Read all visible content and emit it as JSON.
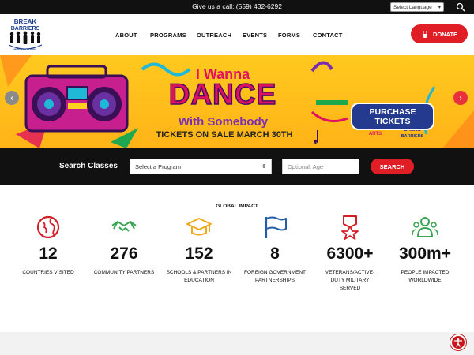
{
  "topbar": {
    "call_text": "Give us a call: (559) 432-6292",
    "language": "Select Language"
  },
  "logo": {
    "line1": "BREAK",
    "line2": "BARRIERS",
    "line3": "INTERNATIONAL"
  },
  "nav": {
    "items": [
      "ABOUT",
      "PROGRAMS",
      "OUTREACH",
      "EVENTS",
      "FORMS",
      "CONTACT"
    ],
    "donate": "DONATE"
  },
  "banner": {
    "line1": "I Wanna",
    "line2": "DANCE",
    "line3": "With Somebody",
    "line4": "TICKETS ON SALE MARCH 30TH",
    "cta_line1": "PURCHASE",
    "cta_line2": "TICKETS"
  },
  "search": {
    "label": "Search Classes",
    "select_value": "Select a Program",
    "age_placeholder": "Optional: Age",
    "button": "SEARCH"
  },
  "impact": {
    "title": "GLOBAL IMPACT",
    "stats": [
      {
        "number": "12",
        "label": "COUNTRIES VISITED"
      },
      {
        "number": "276",
        "label": "COMMUNITY PARTNERS"
      },
      {
        "number": "152",
        "label": "SCHOOLS & PARTNERS IN EDUCATION"
      },
      {
        "number": "8",
        "label": "FOREIGN GOVERNMENT PARTNERSHIPS"
      },
      {
        "number": "6300+",
        "label": "VETERANS/ACTIVE-DUTY MILITARY SERVED"
      },
      {
        "number": "300m+",
        "label": "PEOPLE IMPACTED WORLDWIDE"
      }
    ]
  },
  "colors": {
    "brand_red": "#e01e25",
    "dark": "#111111",
    "icon_red": "#d32027",
    "icon_green": "#3aa655",
    "icon_yellow": "#f0a81e",
    "icon_blue": "#245ea8"
  }
}
